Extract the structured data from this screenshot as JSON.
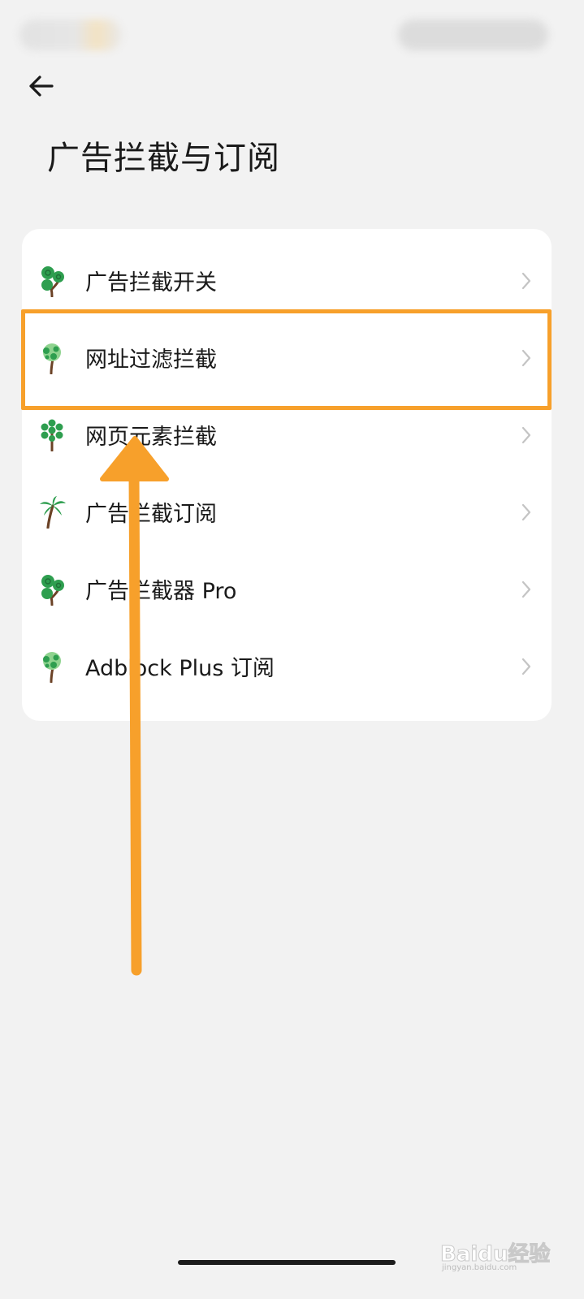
{
  "header": {
    "title": "广告拦截与订阅"
  },
  "menu": {
    "items": [
      {
        "label": "广告拦截开关",
        "icon": "tree-round-icon"
      },
      {
        "label": "网址过滤拦截",
        "icon": "tree-leafy-icon"
      },
      {
        "label": "网页元素拦截",
        "icon": "tree-dotted-icon"
      },
      {
        "label": "广告拦截订阅",
        "icon": "palm-tree-icon"
      },
      {
        "label": "广告拦截器 Pro",
        "icon": "tree-round-icon"
      },
      {
        "label": "Adblock Plus 订阅",
        "icon": "tree-leafy-icon"
      }
    ]
  },
  "annotation": {
    "highlighted_item": "网址过滤拦截",
    "color": "#f7a02b"
  },
  "watermark": {
    "text": "Baidu经验",
    "sub": "jingyan.baidu.com"
  },
  "colors": {
    "background": "#f2f2f2",
    "card": "#ffffff",
    "tree_green": "#2e9e4f",
    "accent_orange": "#f7a02b"
  }
}
